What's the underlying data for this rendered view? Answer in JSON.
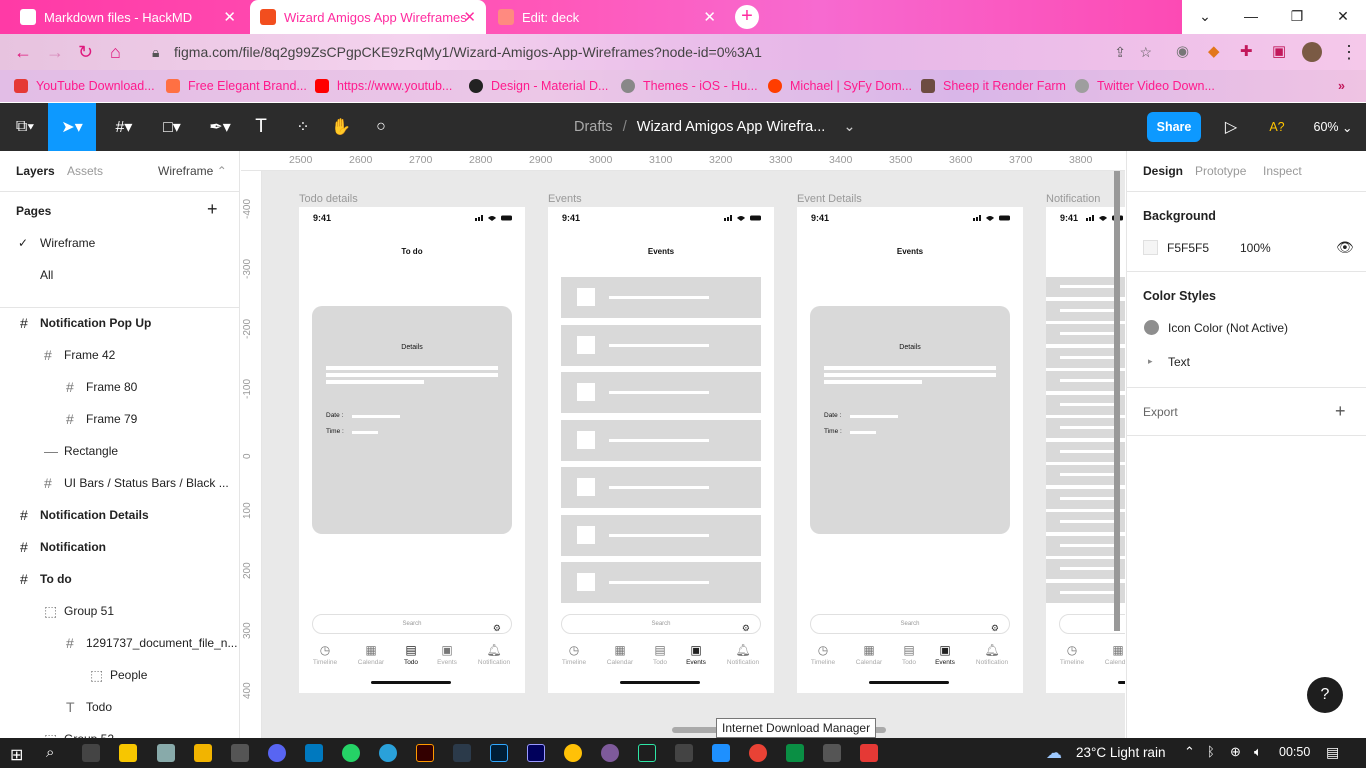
{
  "browser": {
    "tabs": [
      {
        "label": "Markdown files - HackMD",
        "color": "#e91e63"
      },
      {
        "label": "Wizard Amigos App Wireframes",
        "color": "#f24e1e"
      },
      {
        "label": "Edit: deck",
        "color": "#ff5a5f"
      }
    ],
    "url": "figma.com/file/8q2g99ZsCPgpCKE9zRqMy1/Wizard-Amigos-App-Wireframes?node-id=0%3A1",
    "bookmarks": [
      {
        "label": "YouTube Download...",
        "color": "#e53935"
      },
      {
        "label": "Free Elegant Brand...",
        "color": "#ff7043"
      },
      {
        "label": "https://www.youtub...",
        "color": "#ff0000"
      },
      {
        "label": "Design - Material D...",
        "color": "#222222"
      },
      {
        "label": "Themes - iOS - Hu...",
        "color": "#888888"
      },
      {
        "label": "Michael | SyFy Dom...",
        "color": "#ff3d00"
      },
      {
        "label": "Sheep it Render Farm",
        "color": "#6d4c41"
      },
      {
        "label": "Twitter Video Down...",
        "color": "#9e9e9e"
      }
    ],
    "more_bookmarks": "»"
  },
  "figma": {
    "breadcrumb": "Drafts",
    "separator": "/",
    "file_title": "Wizard Amigos App Wirefra...",
    "share_label": "Share",
    "font_warning": "A?",
    "zoom": "60%",
    "accent": "#0d99ff"
  },
  "left_panel": {
    "tabs": [
      "Layers",
      "Assets"
    ],
    "page_selector": "Wireframe",
    "pages_header": "Pages",
    "pages": [
      "Wireframe",
      "All"
    ],
    "layers": [
      {
        "label": "Notification Pop Up",
        "icon": "#",
        "bold": true,
        "indent": 0
      },
      {
        "label": "Frame 42",
        "icon": "#",
        "bold": false,
        "indent": 1
      },
      {
        "label": "Frame 80",
        "icon": "#",
        "bold": false,
        "indent": 2
      },
      {
        "label": "Frame 79",
        "icon": "#",
        "bold": false,
        "indent": 2
      },
      {
        "label": "Rectangle",
        "icon": "—",
        "bold": false,
        "indent": 1
      },
      {
        "label": "UI Bars / Status Bars / Black ...",
        "icon": "#",
        "bold": false,
        "indent": 1
      },
      {
        "label": "Notification Details",
        "icon": "#",
        "bold": true,
        "indent": 0
      },
      {
        "label": "Notification",
        "icon": "#",
        "bold": true,
        "indent": 0
      },
      {
        "label": "To do",
        "icon": "#",
        "bold": true,
        "indent": 0
      },
      {
        "label": "Group 51",
        "icon": "⬚",
        "bold": false,
        "indent": 1
      },
      {
        "label": "1291737_document_file_n...",
        "icon": "#",
        "bold": false,
        "indent": 2
      },
      {
        "label": "People",
        "icon": "⬚",
        "bold": false,
        "indent": 3
      },
      {
        "label": "Todo",
        "icon": "T",
        "bold": false,
        "indent": 2
      },
      {
        "label": "Group 52",
        "icon": "⬚",
        "bold": false,
        "indent": 1
      }
    ]
  },
  "rulers": {
    "top": [
      "2500",
      "2600",
      "2700",
      "2800",
      "2900",
      "3000",
      "3100",
      "3200",
      "3300",
      "3400",
      "3500",
      "3600",
      "3700",
      "3800"
    ],
    "left": [
      "-400",
      "-300",
      "-200",
      "-100",
      "0",
      "100",
      "200",
      "300",
      "400"
    ]
  },
  "canvas": {
    "frames": [
      {
        "label": "Todo details",
        "time": "9:41",
        "title": "To do",
        "kind": "details",
        "card_title": "Details",
        "date_label": "Date :",
        "time_label": "Time :",
        "active_nav": 2
      },
      {
        "label": "Events",
        "time": "9:41",
        "title": "Events",
        "kind": "list",
        "active_nav": 3
      },
      {
        "label": "Event Details",
        "time": "9:41",
        "title": "Events",
        "kind": "details",
        "card_title": "Details",
        "date_label": "Date :",
        "time_label": "Time :",
        "active_nav": 3
      },
      {
        "label": "Notification",
        "time": "9:41",
        "title": "",
        "kind": "partial",
        "active_nav": -1
      }
    ],
    "search_placeholder": "Search",
    "nav_items": [
      "Timeline",
      "Calendar",
      "Todo",
      "Events",
      "Notification"
    ],
    "tooltip": "Internet Download Manager"
  },
  "right_panel": {
    "tabs": [
      "Design",
      "Prototype",
      "Inspect"
    ],
    "background_header": "Background",
    "background_hex": "F5F5F5",
    "background_opacity": "100%",
    "color_styles_header": "Color Styles",
    "color_style_item": "Icon Color (Not Active)",
    "color_style_swatch": "#8e8e8e",
    "text_group": "Text",
    "export_label": "Export",
    "help": "?"
  },
  "taskbar": {
    "weather": "23°C  Light rain",
    "time": "00:50"
  }
}
